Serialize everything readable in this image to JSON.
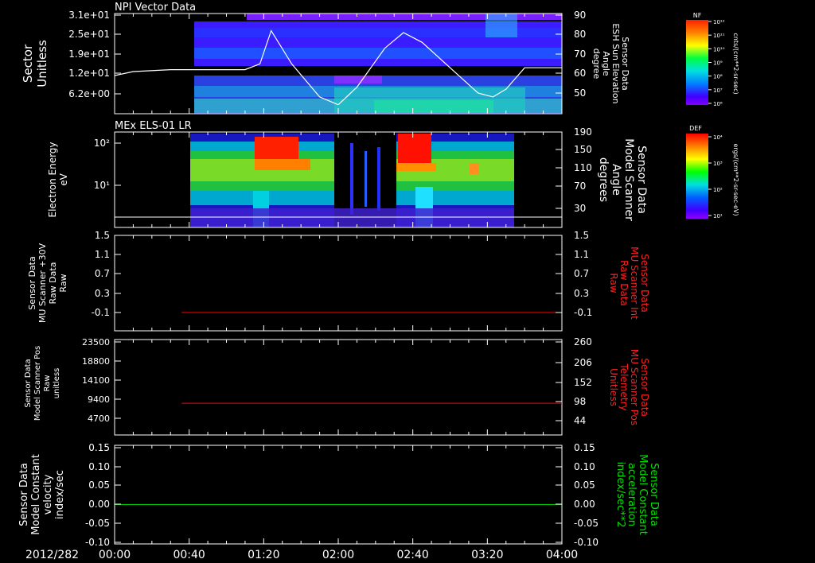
{
  "date_label": "2012/282",
  "time_ticks": [
    "00:00",
    "00:40",
    "01:20",
    "02:00",
    "02:40",
    "03:20",
    "04:00"
  ],
  "panel1": {
    "title": "NPI Vector Data",
    "ylabel_lines": [
      "Sector",
      "Unitless"
    ],
    "yticks": [
      "3.1e+01",
      "2.5e+01",
      "1.9e+01",
      "1.2e+01",
      "6.2e+00"
    ],
    "right_label_lines": [
      "Sensor Data",
      "ESH Sun Elevation",
      "Angle",
      "degree"
    ],
    "right_ticks": [
      "90",
      "80",
      "70",
      "60",
      "50"
    ],
    "colorbar_title": "NF",
    "colorbar_unit": "cnts/(cm**2-sr-sec)",
    "colorbar_ticks": [
      "10¹²",
      "10¹¹",
      "10¹⁰",
      "10⁹",
      "10⁸",
      "10⁷",
      "10⁶"
    ]
  },
  "panel2": {
    "title": "MEx ELS-01 LR",
    "ylabel_lines": [
      "Electron Energy",
      "eV"
    ],
    "yticks": [
      "10²",
      "10¹"
    ],
    "right_label_lines": [
      "Sensor Data",
      "Model Scanner",
      "Angle",
      "degrees"
    ],
    "right_ticks": [
      "190",
      "150",
      "110",
      "70",
      "30"
    ],
    "colorbar_title": "DEF",
    "colorbar_unit": "ergs/(cm**2-sr-sec-eV)",
    "colorbar_ticks": [
      "10⁴",
      "10³",
      "10²",
      "10¹"
    ]
  },
  "panel3": {
    "ylabel_lines": [
      "Sensor Data",
      "MU Scanner +30V",
      "Raw Data",
      "Raw"
    ],
    "yticks": [
      "1.5",
      "1.1",
      "0.7",
      "0.3",
      "-0.1"
    ],
    "right_label_lines": [
      "Sensor Data",
      "MU Scanner Int",
      "Raw Data",
      "Raw"
    ],
    "right_ticks": [
      "1.5",
      "1.1",
      "0.7",
      "0.3",
      "-0.1"
    ]
  },
  "panel4": {
    "ylabel_lines": [
      "Sensor Data",
      "Model Scanner Pos",
      "Raw",
      "unitless"
    ],
    "yticks": [
      "23500",
      "18800",
      "14100",
      "9400",
      "4700"
    ],
    "right_label_lines": [
      "Sensor Data",
      "MU Scanner Pos",
      "Telemetry",
      "Unitless"
    ],
    "right_ticks": [
      "260",
      "206",
      "152",
      "98",
      "44"
    ]
  },
  "panel5": {
    "ylabel_lines": [
      "Sensor Data",
      "Model Constant",
      "velocity",
      "index/sec"
    ],
    "yticks": [
      "0.15",
      "0.10",
      "0.05",
      "0.00",
      "-0.05",
      "-0.10"
    ],
    "right_label_lines": [
      "Sensor Data",
      "Model Constant",
      "acceleration",
      "index/sec**2"
    ],
    "right_ticks": [
      "0.15",
      "0.10",
      "0.05",
      "0.00",
      "-0.05",
      "-0.10"
    ]
  },
  "colors": {
    "red_trace": "#ff0000",
    "green_trace": "#00e000",
    "right_label_red": "#ff2020",
    "right_label_green": "#00e000"
  },
  "chart_data": [
    {
      "type": "heatmap",
      "title": "NPI Vector Data",
      "ylabel": "Sector Unitless",
      "x_range": [
        "00:00",
        "04:00"
      ],
      "data_start": "00:42",
      "overlay_series": {
        "name": "Sensor Data ESH Sun Elevation Angle",
        "x": [
          "00:00",
          "00:10",
          "00:30",
          "01:00",
          "01:10",
          "01:18",
          "01:24",
          "01:35",
          "01:50",
          "02:00",
          "02:10",
          "02:25",
          "02:35",
          "02:45",
          "03:00",
          "03:15",
          "03:23",
          "03:30",
          "03:40",
          "04:00"
        ],
        "y": [
          59,
          61,
          62,
          62,
          62,
          65,
          82,
          65,
          48,
          44,
          53,
          73,
          81,
          76,
          63,
          50,
          48,
          52,
          63,
          63
        ]
      }
    },
    {
      "type": "heatmap",
      "title": "MEx ELS-01 LR",
      "ylabel": "Electron Energy eV",
      "x_range": [
        "00:00",
        "04:00"
      ],
      "data_start": "00:40",
      "data_end": "03:32",
      "overlay_series": {
        "name": "Sensor Data Model Scanner Angle",
        "x": [
          "00:00",
          "04:00"
        ],
        "y": [
          14,
          14
        ]
      }
    },
    {
      "type": "line",
      "series": [
        {
          "name": "Sensor Data MU Scanner Int Raw Data",
          "x": [
            "00:36",
            "04:00"
          ],
          "y": [
            0,
            0
          ]
        }
      ],
      "ylim": [
        -0.3,
        1.5
      ]
    },
    {
      "type": "line",
      "series": [
        {
          "name": "Sensor Data MU Scanner Pos Telemetry",
          "x": [
            "00:36",
            "04:00"
          ],
          "y": [
            8400,
            8400
          ]
        }
      ],
      "ylim": [
        0,
        23500
      ]
    },
    {
      "type": "line",
      "series": [
        {
          "name": "Sensor Data Model Constant acceleration",
          "x": [
            "00:00",
            "04:00"
          ],
          "y": [
            0,
            0
          ]
        }
      ],
      "ylim": [
        -0.1,
        0.15
      ]
    }
  ]
}
